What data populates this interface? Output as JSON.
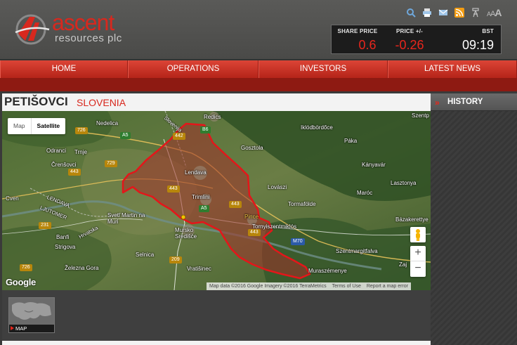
{
  "brand": {
    "name": "ascent",
    "sub": "resources plc",
    "color": "#d8281e"
  },
  "utility_icons": [
    "search-icon",
    "print-icon",
    "email-icon",
    "rss-icon",
    "accessibility-icon",
    "font-size-icon"
  ],
  "font_size": {
    "small": "A",
    "mid": "A",
    "large": "A"
  },
  "price": {
    "share_price_label": "SHARE PRICE",
    "share_price": "0.6",
    "change_label": "PRICE +/-",
    "change": "-0.26",
    "tz_label": "BST",
    "time": "09:19"
  },
  "nav": [
    {
      "label": "HOME"
    },
    {
      "label": "OPERATIONS"
    },
    {
      "label": "INVESTORS"
    },
    {
      "label": "LATEST NEWS"
    }
  ],
  "page": {
    "place": "PETIŠOVCI",
    "country": "SLOVENIA"
  },
  "map": {
    "type_buttons": [
      "Map",
      "Satellite"
    ],
    "active_type": "Satellite",
    "zoom_in": "+",
    "zoom_out": "−",
    "google": "Google",
    "attribution": [
      "Map data ©2016 Google Imagery ©2016 TerraMetrics",
      "Terms of Use",
      "Report a map error"
    ],
    "places": [
      "Redics",
      "Nedelica",
      "Iklódbördőce",
      "Szentp",
      "Gosztola",
      "Páka",
      "Odranci",
      "Trnje",
      "Črenšovci",
      "Lendava",
      "Kányavár",
      "Trimlini",
      "Lovászi",
      "Maróc",
      "Lasztonya",
      "Cven",
      "LENDAVA",
      "LJUTOMER",
      "Tormafölde",
      "Bázakerettye",
      "Sveti Martin na Muri",
      "Mursko Središće",
      "Tornyiszentmiklós",
      "Banfi",
      "Strigova",
      "Selnica",
      "Szentmargitfalva",
      "Železna Gora",
      "Vratišinec",
      "Muraszémenye",
      "Pince",
      "Slovenija",
      "Hrvatska",
      "Zaj"
    ],
    "roads": [
      "726",
      "A5",
      "B6",
      "729",
      "443",
      "442",
      "443",
      "A5",
      "443",
      "231",
      "209",
      "M70",
      "726",
      "443"
    ],
    "colors": {
      "boundary": "#e4161a",
      "fill": "#a0312a"
    }
  },
  "thumb": {
    "label": "MAP"
  },
  "sidebar": {
    "title": "HISTORY"
  }
}
